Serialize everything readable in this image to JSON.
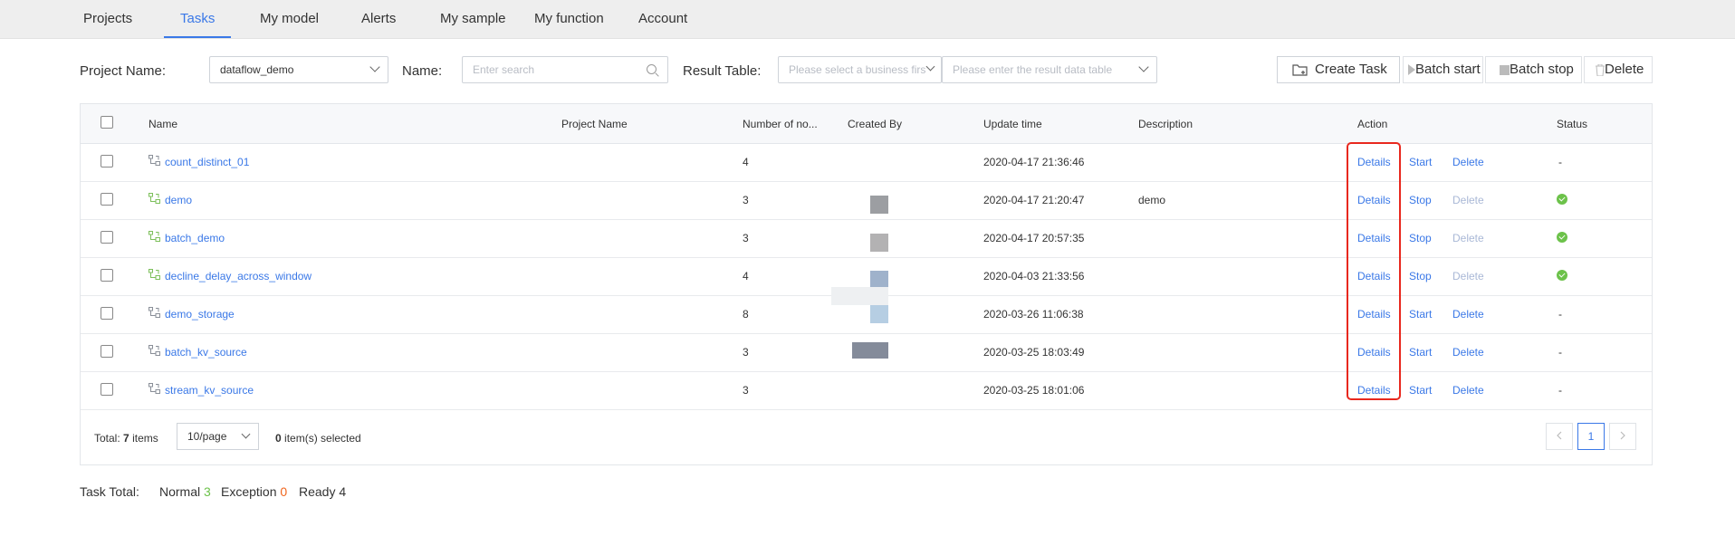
{
  "nav": {
    "tabs": [
      {
        "label": "Projects"
      },
      {
        "label": "Tasks",
        "active": true
      },
      {
        "label": "My model"
      },
      {
        "label": "Alerts"
      },
      {
        "label": "My sample"
      },
      {
        "label": "My function"
      },
      {
        "label": "Account"
      }
    ]
  },
  "filters": {
    "project_label": "Project Name:",
    "project_value": "dataflow_demo",
    "name_label": "Name:",
    "name_placeholder": "Enter search",
    "result_label": "Result Table:",
    "business_placeholder": "Please select a business firs",
    "result_placeholder": "Please enter the result data table"
  },
  "toolbar": {
    "create": "Create Task",
    "batch_start": "Batch start",
    "batch_stop": "Batch stop",
    "delete": "Delete"
  },
  "table": {
    "headers": {
      "name": "Name",
      "project": "Project Name",
      "nodes": "Number of no...",
      "created_by": "Created By",
      "update": "Update time",
      "description": "Description",
      "action": "Action",
      "status": "Status"
    },
    "rows": [
      {
        "name": "count_distinct_01",
        "nodes": "4",
        "update": "2020-04-17 21:36:46",
        "description": "",
        "details": "Details",
        "toggle": "Start",
        "delete": "Delete",
        "status": "-",
        "running": false
      },
      {
        "name": "demo",
        "nodes": "3",
        "update": "2020-04-17 21:20:47",
        "description": "demo",
        "details": "Details",
        "toggle": "Stop",
        "delete": "Delete",
        "status": "",
        "running": true
      },
      {
        "name": "batch_demo",
        "nodes": "3",
        "update": "2020-04-17 20:57:35",
        "description": "",
        "details": "Details",
        "toggle": "Stop",
        "delete": "Delete",
        "status": "",
        "running": true
      },
      {
        "name": "decline_delay_across_window",
        "nodes": "4",
        "update": "2020-04-03 21:33:56",
        "description": "",
        "details": "Details",
        "toggle": "Stop",
        "delete": "Delete",
        "status": "",
        "running": true
      },
      {
        "name": "demo_storage",
        "nodes": "8",
        "update": "2020-03-26 11:06:38",
        "description": "",
        "details": "Details",
        "toggle": "Start",
        "delete": "Delete",
        "status": "-",
        "running": false
      },
      {
        "name": "batch_kv_source",
        "nodes": "3",
        "update": "2020-03-25 18:03:49",
        "description": "",
        "details": "Details",
        "toggle": "Start",
        "delete": "Delete",
        "status": "-",
        "running": false
      },
      {
        "name": "stream_kv_source",
        "nodes": "3",
        "update": "2020-03-25 18:01:06",
        "description": "",
        "details": "Details",
        "toggle": "Start",
        "delete": "Delete",
        "status": "-",
        "running": false
      }
    ]
  },
  "footer": {
    "total_prefix": "Total:",
    "total_count": "7",
    "total_suffix": "items",
    "page_size": "10/page",
    "selected_count": "0",
    "selected_suffix": "item(s) selected",
    "current_page": "1"
  },
  "summary": {
    "label": "Task Total:",
    "normal_label": "Normal",
    "normal_count": "3",
    "exception_label": "Exception",
    "exception_count": "0",
    "ready_label": "Ready",
    "ready_count": "4"
  },
  "colors": {
    "accent": "#3a78e7",
    "ok": "#6cc24a",
    "exception": "#f0651d",
    "highlight": "#e8281e"
  }
}
